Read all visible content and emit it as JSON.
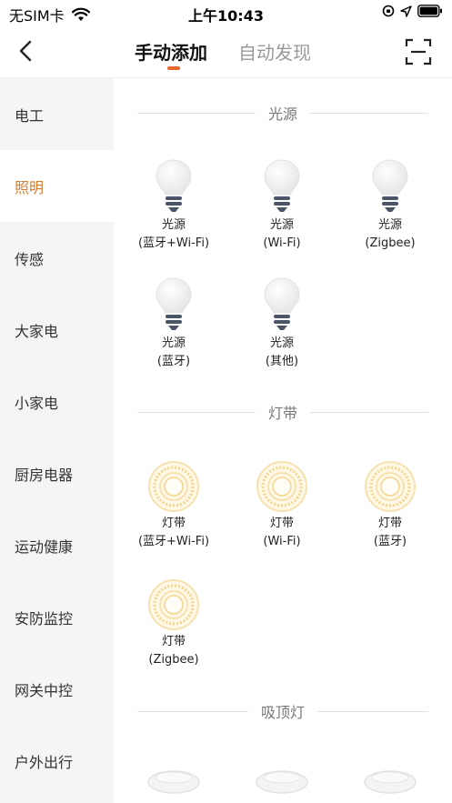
{
  "status_bar": {
    "carrier": "无SIM卡",
    "time": "上午10:43"
  },
  "header": {
    "tabs": [
      {
        "label": "手动添加",
        "active": true
      },
      {
        "label": "自动发现",
        "active": false
      }
    ],
    "accent_color": "#e9662d"
  },
  "sidebar": {
    "items": [
      {
        "label": "电工",
        "active": false
      },
      {
        "label": "照明",
        "active": true
      },
      {
        "label": "传感",
        "active": false
      },
      {
        "label": "大家电",
        "active": false
      },
      {
        "label": "小家电",
        "active": false
      },
      {
        "label": "厨房电器",
        "active": false
      },
      {
        "label": "运动健康",
        "active": false
      },
      {
        "label": "安防监控",
        "active": false
      },
      {
        "label": "网关中控",
        "active": false
      },
      {
        "label": "户外出行",
        "active": false
      }
    ],
    "active_color": "#d87a2d"
  },
  "sections": [
    {
      "title": "光源",
      "items": [
        {
          "line1": "光源",
          "line2": "(蓝牙+Wi-Fi)",
          "icon": "bulb-icon"
        },
        {
          "line1": "光源",
          "line2": "(Wi-Fi)",
          "icon": "bulb-icon"
        },
        {
          "line1": "光源",
          "line2": "(Zigbee)",
          "icon": "bulb-icon"
        },
        {
          "line1": "光源",
          "line2": "(蓝牙)",
          "icon": "bulb-icon"
        },
        {
          "line1": "光源",
          "line2": "(其他)",
          "icon": "bulb-icon"
        }
      ]
    },
    {
      "title": "灯带",
      "items": [
        {
          "line1": "灯带",
          "line2": "(蓝牙+Wi-Fi)",
          "icon": "light-strip-icon"
        },
        {
          "line1": "灯带",
          "line2": "(Wi-Fi)",
          "icon": "light-strip-icon"
        },
        {
          "line1": "灯带",
          "line2": "(蓝牙)",
          "icon": "light-strip-icon"
        },
        {
          "line1": "灯带",
          "line2": "(Zigbee)",
          "icon": "light-strip-icon"
        }
      ]
    },
    {
      "title": "吸顶灯",
      "items": []
    }
  ]
}
